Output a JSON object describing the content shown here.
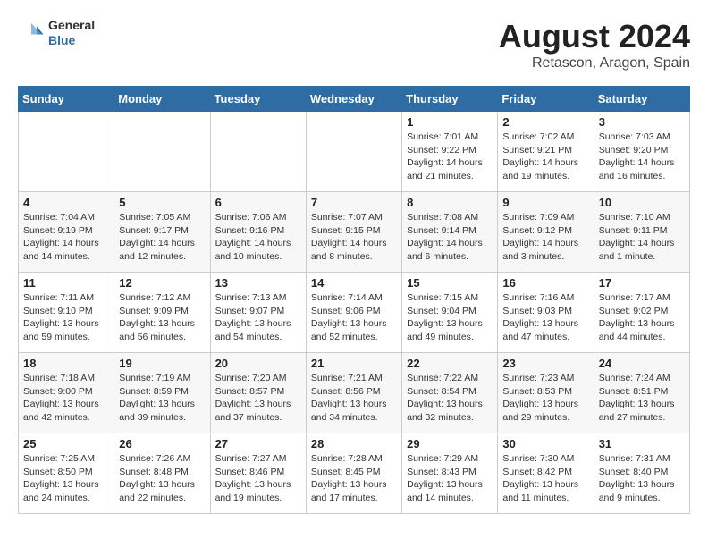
{
  "header": {
    "logo_general": "General",
    "logo_blue": "Blue",
    "title": "August 2024",
    "subtitle": "Retascon, Aragon, Spain"
  },
  "days_of_week": [
    "Sunday",
    "Monday",
    "Tuesday",
    "Wednesday",
    "Thursday",
    "Friday",
    "Saturday"
  ],
  "weeks": [
    [
      {
        "day": "",
        "detail": ""
      },
      {
        "day": "",
        "detail": ""
      },
      {
        "day": "",
        "detail": ""
      },
      {
        "day": "",
        "detail": ""
      },
      {
        "day": "1",
        "detail": "Sunrise: 7:01 AM\nSunset: 9:22 PM\nDaylight: 14 hours\nand 21 minutes."
      },
      {
        "day": "2",
        "detail": "Sunrise: 7:02 AM\nSunset: 9:21 PM\nDaylight: 14 hours\nand 19 minutes."
      },
      {
        "day": "3",
        "detail": "Sunrise: 7:03 AM\nSunset: 9:20 PM\nDaylight: 14 hours\nand 16 minutes."
      }
    ],
    [
      {
        "day": "4",
        "detail": "Sunrise: 7:04 AM\nSunset: 9:19 PM\nDaylight: 14 hours\nand 14 minutes."
      },
      {
        "day": "5",
        "detail": "Sunrise: 7:05 AM\nSunset: 9:17 PM\nDaylight: 14 hours\nand 12 minutes."
      },
      {
        "day": "6",
        "detail": "Sunrise: 7:06 AM\nSunset: 9:16 PM\nDaylight: 14 hours\nand 10 minutes."
      },
      {
        "day": "7",
        "detail": "Sunrise: 7:07 AM\nSunset: 9:15 PM\nDaylight: 14 hours\nand 8 minutes."
      },
      {
        "day": "8",
        "detail": "Sunrise: 7:08 AM\nSunset: 9:14 PM\nDaylight: 14 hours\nand 6 minutes."
      },
      {
        "day": "9",
        "detail": "Sunrise: 7:09 AM\nSunset: 9:12 PM\nDaylight: 14 hours\nand 3 minutes."
      },
      {
        "day": "10",
        "detail": "Sunrise: 7:10 AM\nSunset: 9:11 PM\nDaylight: 14 hours\nand 1 minute."
      }
    ],
    [
      {
        "day": "11",
        "detail": "Sunrise: 7:11 AM\nSunset: 9:10 PM\nDaylight: 13 hours\nand 59 minutes."
      },
      {
        "day": "12",
        "detail": "Sunrise: 7:12 AM\nSunset: 9:09 PM\nDaylight: 13 hours\nand 56 minutes."
      },
      {
        "day": "13",
        "detail": "Sunrise: 7:13 AM\nSunset: 9:07 PM\nDaylight: 13 hours\nand 54 minutes."
      },
      {
        "day": "14",
        "detail": "Sunrise: 7:14 AM\nSunset: 9:06 PM\nDaylight: 13 hours\nand 52 minutes."
      },
      {
        "day": "15",
        "detail": "Sunrise: 7:15 AM\nSunset: 9:04 PM\nDaylight: 13 hours\nand 49 minutes."
      },
      {
        "day": "16",
        "detail": "Sunrise: 7:16 AM\nSunset: 9:03 PM\nDaylight: 13 hours\nand 47 minutes."
      },
      {
        "day": "17",
        "detail": "Sunrise: 7:17 AM\nSunset: 9:02 PM\nDaylight: 13 hours\nand 44 minutes."
      }
    ],
    [
      {
        "day": "18",
        "detail": "Sunrise: 7:18 AM\nSunset: 9:00 PM\nDaylight: 13 hours\nand 42 minutes."
      },
      {
        "day": "19",
        "detail": "Sunrise: 7:19 AM\nSunset: 8:59 PM\nDaylight: 13 hours\nand 39 minutes."
      },
      {
        "day": "20",
        "detail": "Sunrise: 7:20 AM\nSunset: 8:57 PM\nDaylight: 13 hours\nand 37 minutes."
      },
      {
        "day": "21",
        "detail": "Sunrise: 7:21 AM\nSunset: 8:56 PM\nDaylight: 13 hours\nand 34 minutes."
      },
      {
        "day": "22",
        "detail": "Sunrise: 7:22 AM\nSunset: 8:54 PM\nDaylight: 13 hours\nand 32 minutes."
      },
      {
        "day": "23",
        "detail": "Sunrise: 7:23 AM\nSunset: 8:53 PM\nDaylight: 13 hours\nand 29 minutes."
      },
      {
        "day": "24",
        "detail": "Sunrise: 7:24 AM\nSunset: 8:51 PM\nDaylight: 13 hours\nand 27 minutes."
      }
    ],
    [
      {
        "day": "25",
        "detail": "Sunrise: 7:25 AM\nSunset: 8:50 PM\nDaylight: 13 hours\nand 24 minutes."
      },
      {
        "day": "26",
        "detail": "Sunrise: 7:26 AM\nSunset: 8:48 PM\nDaylight: 13 hours\nand 22 minutes."
      },
      {
        "day": "27",
        "detail": "Sunrise: 7:27 AM\nSunset: 8:46 PM\nDaylight: 13 hours\nand 19 minutes."
      },
      {
        "day": "28",
        "detail": "Sunrise: 7:28 AM\nSunset: 8:45 PM\nDaylight: 13 hours\nand 17 minutes."
      },
      {
        "day": "29",
        "detail": "Sunrise: 7:29 AM\nSunset: 8:43 PM\nDaylight: 13 hours\nand 14 minutes."
      },
      {
        "day": "30",
        "detail": "Sunrise: 7:30 AM\nSunset: 8:42 PM\nDaylight: 13 hours\nand 11 minutes."
      },
      {
        "day": "31",
        "detail": "Sunrise: 7:31 AM\nSunset: 8:40 PM\nDaylight: 13 hours\nand 9 minutes."
      }
    ]
  ]
}
